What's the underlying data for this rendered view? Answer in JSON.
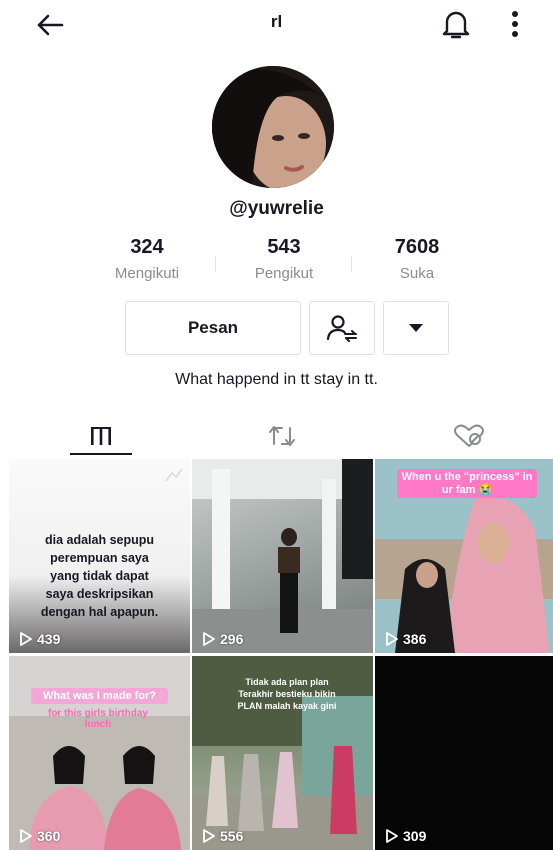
{
  "header": {
    "title": "rl"
  },
  "profile": {
    "username": "@yuwrelie",
    "bio": "What happend in tt stay in tt."
  },
  "stats": [
    {
      "value": "324",
      "label": "Mengikuti"
    },
    {
      "value": "543",
      "label": "Pengikut"
    },
    {
      "value": "7608",
      "label": "Suka"
    }
  ],
  "actions": {
    "message_label": "Pesan"
  },
  "tabs": [
    "videos-grid",
    "reposts",
    "liked-private"
  ],
  "grid": [
    {
      "views": "439",
      "caption_lines": [
        "dia adalah sepupu",
        "perempuan saya",
        "yang tidak dapat",
        "saya deskripsikan",
        "dengan hal apapun."
      ]
    },
    {
      "views": "296"
    },
    {
      "views": "386",
      "overlay": "When u the \"princess\" in ur fam 😭"
    },
    {
      "views": "360",
      "overlay": "What was I made for?",
      "overlay2": "for this girls birthday lunch"
    },
    {
      "views": "556",
      "overlay": "Tidak ada plan plan Terakhir bestieku bikin PLAN malah kayak gini"
    },
    {
      "views": "309"
    }
  ],
  "colors": {
    "text": "#161823",
    "muted": "#8a8b91",
    "border": "#e1e1e3",
    "pink": "#f4a7d6"
  }
}
